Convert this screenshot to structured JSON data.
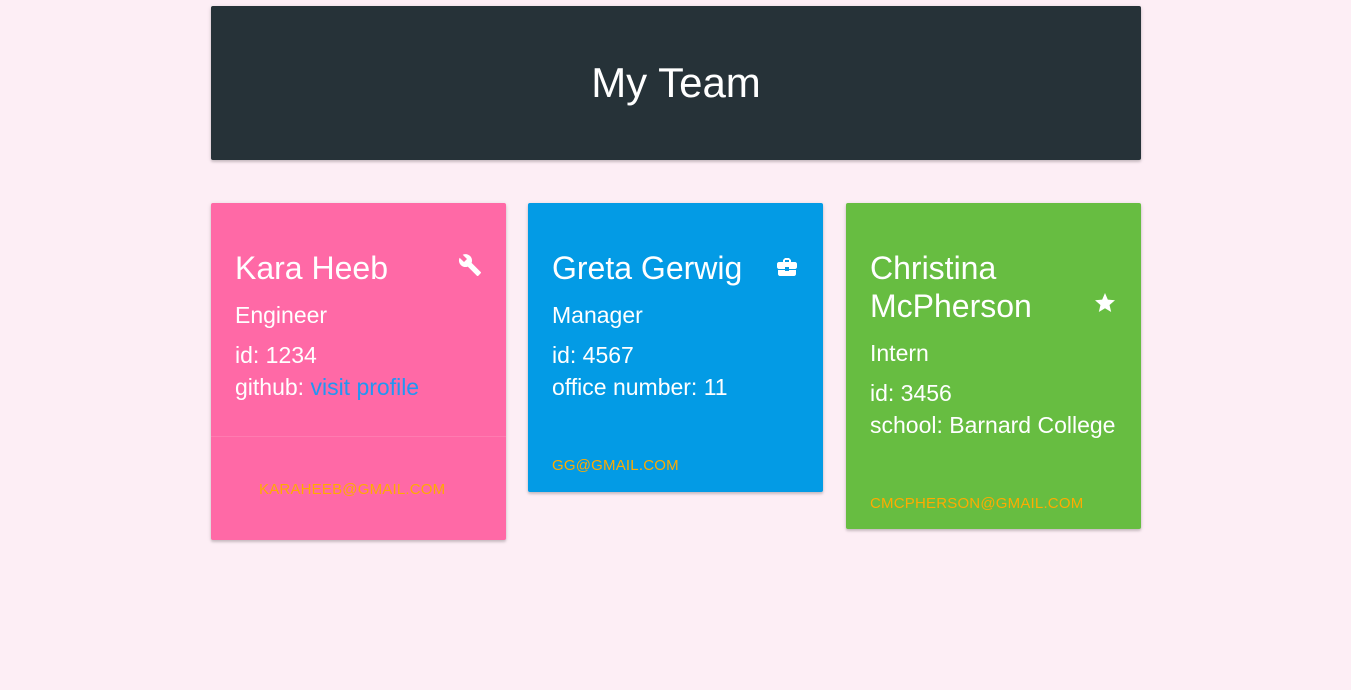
{
  "header": {
    "title": "My Team"
  },
  "cards": [
    {
      "name": "Kara Heeb",
      "role": "Engineer",
      "icon": "wrench-icon",
      "id_label": "id: 1234",
      "extra_label": "github: ",
      "extra_link": "visit profile",
      "email": "KARAHEEB@GMAIL.COM",
      "color": "#ff69a6"
    },
    {
      "name": "Greta Gerwig",
      "role": "Manager",
      "icon": "briefcase-icon",
      "id_label": "id: 4567",
      "extra_label": "office number: 11",
      "email": "GG@GMAIL.COM",
      "color": "#039be5"
    },
    {
      "name": "Christina McPherson",
      "role": "Intern",
      "icon": "star-icon",
      "id_label": "id: 3456",
      "extra_label": "school: Barnard College",
      "email": "CMCPHERSON@GMAIL.COM",
      "color": "#67bd41"
    }
  ],
  "colors": {
    "background": "#fdeef5",
    "header": "#263238",
    "email": "#ffab00",
    "link": "#2196f3"
  }
}
